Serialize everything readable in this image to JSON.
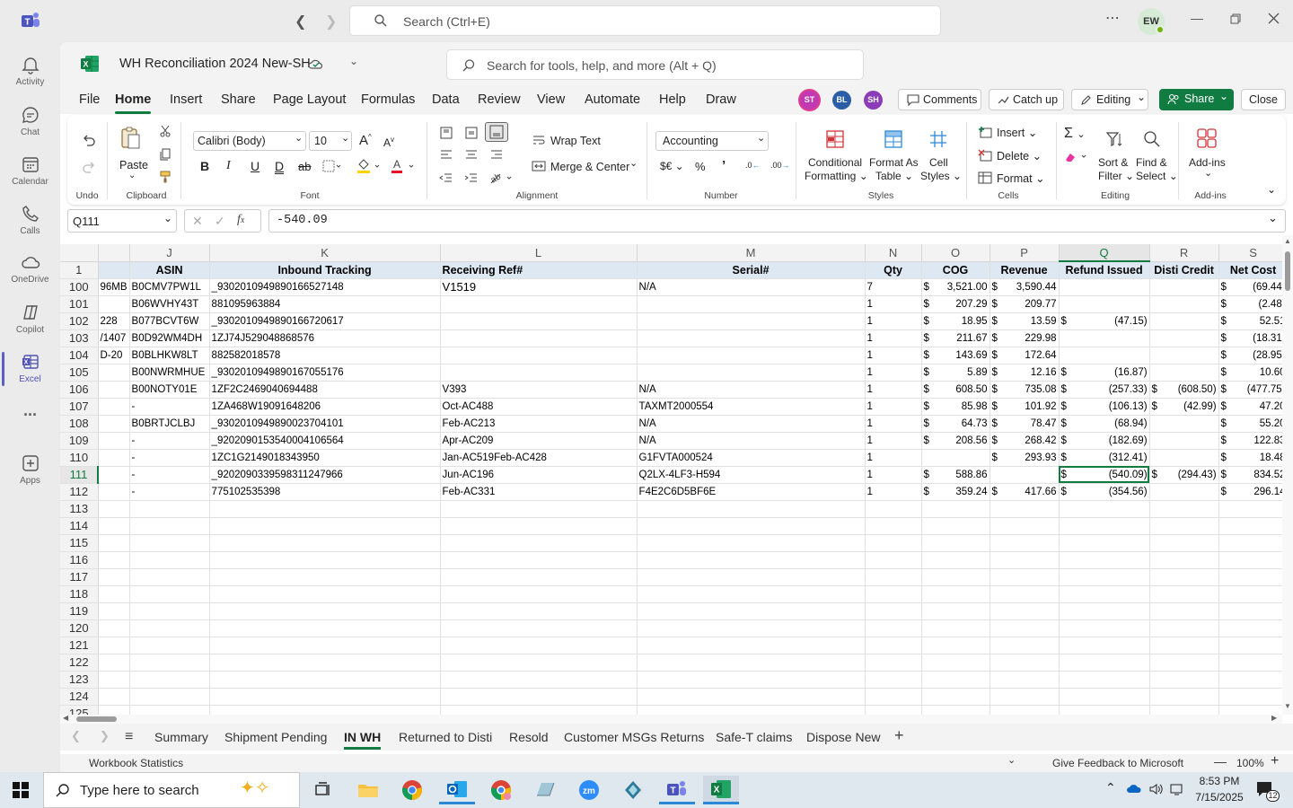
{
  "teams": {
    "search_placeholder": "Search (Ctrl+E)",
    "avatar_initials": "EW",
    "rail": [
      {
        "label": "Activity",
        "icon": "bell-icon"
      },
      {
        "label": "Chat",
        "icon": "chat-icon"
      },
      {
        "label": "Calendar",
        "icon": "calendar-icon"
      },
      {
        "label": "Calls",
        "icon": "phone-icon"
      },
      {
        "label": "OneDrive",
        "icon": "cloud-icon"
      },
      {
        "label": "Copilot",
        "icon": "copilot-icon"
      },
      {
        "label": "Excel",
        "icon": "excel-icon"
      },
      {
        "label": "...",
        "icon": "more-icon"
      },
      {
        "label": "Apps",
        "icon": "add-app-icon"
      }
    ]
  },
  "excel": {
    "file_name": "WH Reconciliation 2024 New-SH",
    "tools_search_placeholder": "Search for tools, help, and more (Alt + Q)",
    "menu": [
      "File",
      "Home",
      "Insert",
      "Share",
      "Page Layout",
      "Formulas",
      "Data",
      "Review",
      "View",
      "Automate",
      "Help",
      "Draw"
    ],
    "active_menu": "Home",
    "collaborators": [
      {
        "initials": "ST",
        "color": "#c239b3"
      },
      {
        "initials": "BL",
        "color": "#2b5ea7"
      },
      {
        "initials": "SH",
        "color": "#8c3cb8"
      }
    ],
    "comments_label": "Comments",
    "catchup_label": "Catch up",
    "editing_label": "Editing",
    "share_label": "Share",
    "close_label": "Close",
    "ribbon": {
      "undo_label": "Undo",
      "paste_label": "Paste",
      "clipboard_label": "Clipboard",
      "font_name": "Calibri (Body)",
      "font_size": "10",
      "font_label": "Font",
      "wrap_text": "Wrap Text",
      "merge_center": "Merge & Center",
      "alignment_label": "Alignment",
      "number_format": "Accounting",
      "number_label": "Number",
      "conditional_formatting_1": "Conditional",
      "conditional_formatting_2": "Formatting",
      "format_as_table_1": "Format As",
      "format_as_table_2": "Table",
      "cell_styles_1": "Cell",
      "cell_styles_2": "Styles",
      "styles_label": "Styles",
      "insert": "Insert",
      "delete": "Delete",
      "format": "Format",
      "cells_label": "Cells",
      "sort_filter_1": "Sort &",
      "sort_filter_2": "Filter",
      "find_select_1": "Find &",
      "find_select_2": "Select",
      "editing_group_label": "Editing",
      "addins_label": "Add-ins",
      "addins_group_label": "Add-ins"
    },
    "name_box": "Q111",
    "formula": "-540.09",
    "columns": [
      {
        "letter": "J",
        "header": "ASIN"
      },
      {
        "letter": "K",
        "header": "Inbound Tracking"
      },
      {
        "letter": "L",
        "header": "Receiving Ref#"
      },
      {
        "letter": "M",
        "header": "Serial#"
      },
      {
        "letter": "N",
        "header": "Qty"
      },
      {
        "letter": "O",
        "header": "COG"
      },
      {
        "letter": "P",
        "header": "Revenue"
      },
      {
        "letter": "Q",
        "header": "Refund Issued"
      },
      {
        "letter": "R",
        "header": "Disti Credit"
      },
      {
        "letter": "S",
        "header": "Net Cost"
      }
    ],
    "rows": [
      {
        "n": "100",
        "i": "96MB",
        "j": "B0CMV7PW1L",
        "k": "_9302010949890166527148",
        "l": "V1519",
        "m": "N/A",
        "q_": "7",
        "o": "3,521.00",
        "p": "3,590.44",
        "rf": "",
        "r": "",
        "s": "(69.44)"
      },
      {
        "n": "101",
        "i": "",
        "j": "B06WVHY43T",
        "k": "881095963884",
        "l": "",
        "m": "",
        "q_": "1",
        "o": "207.29",
        "p": "209.77",
        "rf": "",
        "r": "",
        "s": "(2.48)"
      },
      {
        "n": "102",
        "i": "228",
        "j": "B077BCVT6W",
        "k": "_9302010949890166720617",
        "l": "",
        "m": "",
        "q_": "1",
        "o": "18.95",
        "p": "13.59",
        "rf": "(47.15)",
        "r": "",
        "s": "52.51"
      },
      {
        "n": "103",
        "i": "/1407",
        "j": "B0D92WM4DH",
        "k": "1ZJ74J529048868576",
        "l": "",
        "m": "",
        "q_": "1",
        "o": "211.67",
        "p": "229.98",
        "rf": "",
        "r": "",
        "s": "(18.31)"
      },
      {
        "n": "104",
        "i": "D-20",
        "j": "B0BLHKW8LT",
        "k": "882582018578",
        "l": "",
        "m": "",
        "q_": "1",
        "o": "143.69",
        "p": "172.64",
        "rf": "",
        "r": "",
        "s": "(28.95)"
      },
      {
        "n": "105",
        "i": "",
        "j": "B00NWRMHUE",
        "k": "_9302010949890167055176",
        "l": "",
        "m": "",
        "q_": "1",
        "o": "5.89",
        "p": "12.16",
        "rf": "(16.87)",
        "r": "",
        "s": "10.60"
      },
      {
        "n": "106",
        "i": "",
        "j": "B00NOTY01E",
        "k": "1ZF2C2469040694488",
        "l": "V393",
        "m": "N/A",
        "q_": "1",
        "o": "608.50",
        "p": "735.08",
        "rf": "(257.33)",
        "r": "(608.50)",
        "s": "(477.75)"
      },
      {
        "n": "107",
        "i": "",
        "j": "-",
        "k": "1ZA468W19091648206",
        "l": "Oct-AC488",
        "m": "TAXMT2000554",
        "q_": "1",
        "o": "85.98",
        "p": "101.92",
        "rf": "(106.13)",
        "r": "(42.99)",
        "s": "47.20"
      },
      {
        "n": "108",
        "i": "",
        "j": "B0BRTJCLBJ",
        "k": "_9302010949890023704101",
        "l": "Feb-AC213",
        "m": "N/A",
        "q_": "1",
        "o": "64.73",
        "p": "78.47",
        "rf": "(68.94)",
        "r": "",
        "s": "55.20"
      },
      {
        "n": "109",
        "i": "",
        "j": "-",
        "k": "_9202090153540004106564",
        "l": "Apr-AC209",
        "m": "N/A",
        "q_": "1",
        "o": "208.56",
        "p": "268.42",
        "rf": "(182.69)",
        "r": "",
        "s": "122.83"
      },
      {
        "n": "110",
        "i": "",
        "j": "-",
        "k": "1ZC1G2149018343950",
        "l": "Jan-AC519Feb-AC428",
        "m": "G1FVTA000524",
        "q_": "1",
        "o": "",
        "p": "293.93",
        "rf": "(312.41)",
        "r": "",
        "s": "18.48"
      },
      {
        "n": "111",
        "i": "",
        "j": "-",
        "k": "_9202090339598311247966",
        "l": "Jun-AC196",
        "m": "Q2LX-4LF3-H594",
        "q_": "1",
        "o": "588.86",
        "p": "",
        "rf": "(540.09)",
        "r": "(294.43)",
        "s": "834.52"
      },
      {
        "n": "112",
        "i": "",
        "j": "-",
        "k": "775102535398",
        "l": "Feb-AC331",
        "m": "F4E2C6D5BF6E",
        "q_": "1",
        "o": "359.24",
        "p": "417.66",
        "rf": "(354.56)",
        "r": "",
        "s": "296.14"
      }
    ],
    "empty_rows": [
      "113",
      "114",
      "115",
      "116",
      "117",
      "118",
      "119",
      "120",
      "121",
      "122",
      "123",
      "124",
      "125"
    ],
    "sheet_tabs": [
      "Summary",
      "Shipment Pending",
      "IN WH",
      "Returned to Disti",
      "Resold",
      "Customer MSGs Returns",
      "Safe-T claims",
      "Dispose New"
    ],
    "active_sheet": "IN WH",
    "status_left": "Workbook Statistics",
    "feedback": "Give Feedback to Microsoft",
    "zoom": "100%"
  },
  "taskbar": {
    "search_placeholder": "Type here to search",
    "time": "8:53 PM",
    "date": "7/15/2025",
    "notifications": "12"
  }
}
